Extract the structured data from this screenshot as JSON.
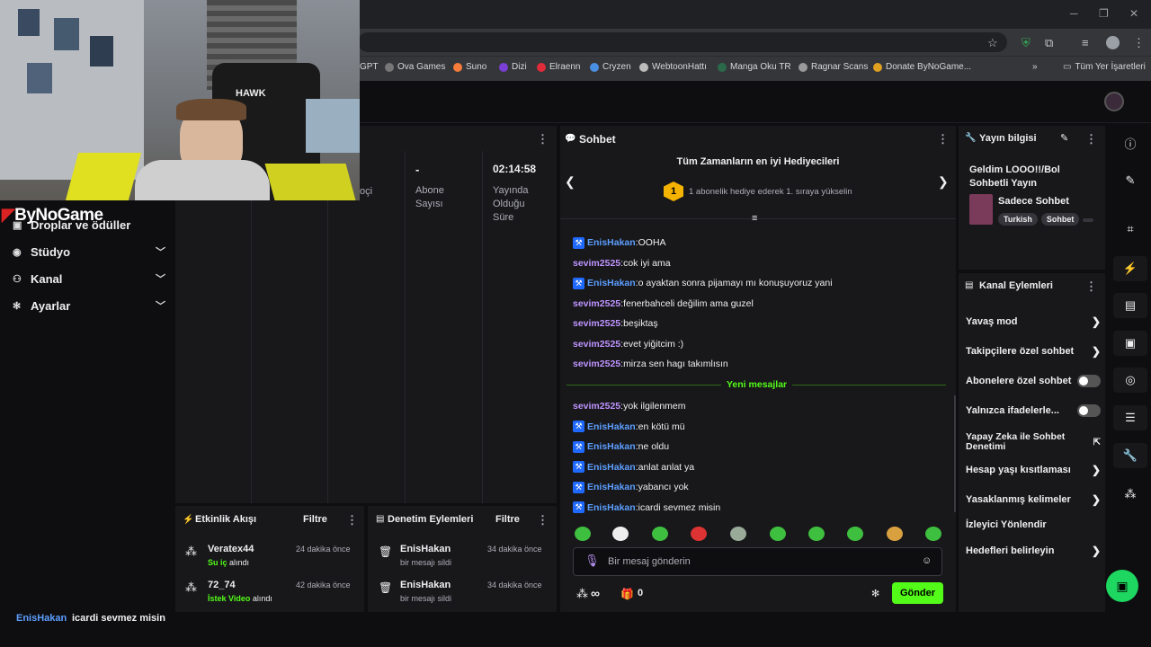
{
  "browser": {
    "win_controls": [
      "─",
      "❐",
      "✕"
    ],
    "bookmarks": [
      "GPT",
      "Ova Games",
      "Suno",
      "Dizi",
      "Elraenn",
      "Cryzen",
      "WebtoonHattı",
      "Manga Oku TR",
      "Ragnar Scans",
      "Donate ByNoGame..."
    ],
    "bookmark_overflow": "»",
    "all_bookmarks": "Tüm Yer İşaretleri"
  },
  "colors": {
    "accent": "#53fc18",
    "purple": "#bf94ff",
    "blue": "#5c9eff",
    "panel": "#18181b",
    "bg": "#0e0e10"
  },
  "overlay": {
    "brand": "ByNoGame",
    "cam_caption": "HAWK"
  },
  "sidebar": {
    "items": [
      {
        "label": "Droplar ve ödüller",
        "icon": "gift-icon"
      },
      {
        "label": "Stüdyo",
        "icon": "studio-icon"
      },
      {
        "label": "Kanal",
        "icon": "channel-icon"
      },
      {
        "label": "Ayarlar",
        "icon": "gear-icon"
      }
    ]
  },
  "stats": {
    "partial": "oçi",
    "subs_value": "-",
    "subs_label": "Abone Sayısı",
    "live_value": "02:14:58",
    "live_label": "Yayında Olduğu Süre"
  },
  "activity": {
    "title": "Etkinlik Akışı",
    "filter": "Filtre",
    "items": [
      {
        "user": "Veratex44",
        "time": "24 dakika önce",
        "highlight": "Su iç",
        "suffix": "alındı"
      },
      {
        "user": "72_74",
        "time": "42 dakika önce",
        "highlight": "İstek Video",
        "suffix": "alındı"
      }
    ]
  },
  "moderation": {
    "title": "Denetim Eylemleri",
    "filter": "Filtre",
    "items": [
      {
        "user": "EnisHakan",
        "time": "34 dakika önce",
        "desc": "bir mesajı sildi"
      },
      {
        "user": "EnisHakan",
        "time": "34 dakika önce",
        "desc": "bir mesajı sildi"
      }
    ]
  },
  "chat": {
    "title": "Sohbet",
    "gifters_title": "Tüm Zamanların en iyi Hediyecileri",
    "gifters_rank": "1",
    "gifters_text": "1 abonelik hediye ederek 1. sıraya yükselin",
    "new_messages": "Yeni mesajlar",
    "messages_before": [
      {
        "user": "EnisHakan",
        "text": "OOHA",
        "mod": true
      },
      {
        "user": "sevim2525",
        "text": "cok iyi ama",
        "mod": false
      },
      {
        "user": "EnisHakan",
        "text": "o ayaktan sonra pijamayı mı konuşuyoruz yani",
        "mod": true
      },
      {
        "user": "sevim2525",
        "text": "fenerbahceli değilim ama guzel",
        "mod": false
      },
      {
        "user": "sevim2525",
        "text": "beşiktaş",
        "mod": false
      },
      {
        "user": "sevim2525",
        "text": "evet yiğitcim :)",
        "mod": false
      },
      {
        "user": "sevim2525",
        "text": "mirza sen hagı takımlısın",
        "mod": false
      }
    ],
    "messages_after": [
      {
        "user": "sevim2525",
        "text": "yok ilgilenmem",
        "mod": false
      },
      {
        "user": "EnisHakan",
        "text": "en kötü mü",
        "mod": true
      },
      {
        "user": "EnisHakan",
        "text": "ne oldu",
        "mod": true
      },
      {
        "user": "EnisHakan",
        "text": "anlat anlat ya",
        "mod": true
      },
      {
        "user": "EnisHakan",
        "text": "yabancı yok",
        "mod": true
      },
      {
        "user": "EnisHakan",
        "text": "icardi sevmez misin",
        "mod": true
      }
    ],
    "input_placeholder": "Bir mesaj gönderin",
    "points": "∞",
    "count": "0",
    "send": "Gönder"
  },
  "stream_info": {
    "title": "Yayın bilgisi",
    "stream_title": "Geldim LOOO!!/Bol Sohbetli Yayın",
    "category": "Sadece Sohbet",
    "tags": [
      "Turkish",
      "Sohbet"
    ]
  },
  "channel_actions": {
    "title": "Kanal Eylemleri",
    "items": [
      {
        "label": "Yavaş mod",
        "control": "chevron"
      },
      {
        "label": "Takipçilere özel sohbet",
        "control": "chevron"
      },
      {
        "label": "Abonelere özel sohbet",
        "control": "toggle"
      },
      {
        "label": "Yalnızca ifadelerle...",
        "control": "toggle"
      },
      {
        "label": "Yapay Zeka ile Sohbet Denetimi",
        "control": "external"
      },
      {
        "label": "Hesap yaşı kısıtlaması",
        "control": "chevron"
      },
      {
        "label": "Yasaklanmış kelimeler",
        "control": "chevron"
      },
      {
        "label": "İzleyici Yönlendir",
        "control": "none"
      },
      {
        "label": "Hedefleri belirleyin",
        "control": "chevron"
      }
    ]
  },
  "overlay_chat": {
    "user": "EnisHakan",
    "text": "icardi sevmez misin"
  }
}
